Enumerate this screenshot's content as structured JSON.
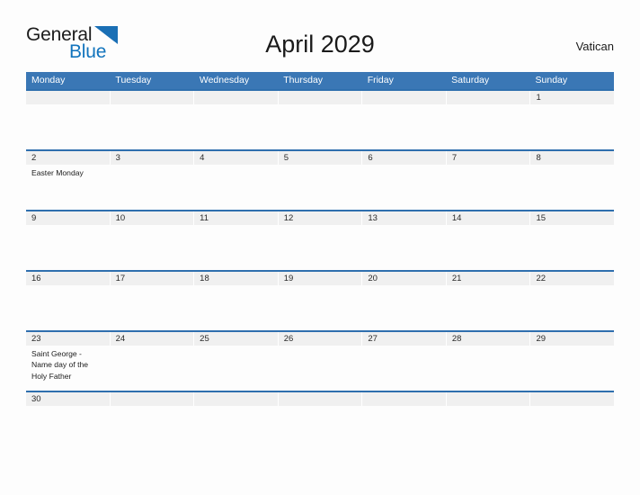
{
  "brand": {
    "name_part1": "General",
    "name_part2": "Blue",
    "mark": "triangle-flag",
    "accent_color": "#1a6fb5"
  },
  "header": {
    "title": "April 2029",
    "region": "Vatican"
  },
  "calendar": {
    "month": "April",
    "year": "2029",
    "header_color": "#3a77b5",
    "row_rule_color": "#2f6fae",
    "number_band_color": "#f0f0f0",
    "day_names": [
      "Monday",
      "Tuesday",
      "Wednesday",
      "Thursday",
      "Friday",
      "Saturday",
      "Sunday"
    ],
    "weeks": [
      {
        "height": "normal",
        "days": [
          {
            "number": "",
            "event": ""
          },
          {
            "number": "",
            "event": ""
          },
          {
            "number": "",
            "event": ""
          },
          {
            "number": "",
            "event": ""
          },
          {
            "number": "",
            "event": ""
          },
          {
            "number": "",
            "event": ""
          },
          {
            "number": "1",
            "event": ""
          }
        ]
      },
      {
        "height": "normal",
        "days": [
          {
            "number": "2",
            "event": "Easter Monday"
          },
          {
            "number": "3",
            "event": ""
          },
          {
            "number": "4",
            "event": ""
          },
          {
            "number": "5",
            "event": ""
          },
          {
            "number": "6",
            "event": ""
          },
          {
            "number": "7",
            "event": ""
          },
          {
            "number": "8",
            "event": ""
          }
        ]
      },
      {
        "height": "normal",
        "days": [
          {
            "number": "9",
            "event": ""
          },
          {
            "number": "10",
            "event": ""
          },
          {
            "number": "11",
            "event": ""
          },
          {
            "number": "12",
            "event": ""
          },
          {
            "number": "13",
            "event": ""
          },
          {
            "number": "14",
            "event": ""
          },
          {
            "number": "15",
            "event": ""
          }
        ]
      },
      {
        "height": "normal",
        "days": [
          {
            "number": "16",
            "event": ""
          },
          {
            "number": "17",
            "event": ""
          },
          {
            "number": "18",
            "event": ""
          },
          {
            "number": "19",
            "event": ""
          },
          {
            "number": "20",
            "event": ""
          },
          {
            "number": "21",
            "event": ""
          },
          {
            "number": "22",
            "event": ""
          }
        ]
      },
      {
        "height": "normal",
        "days": [
          {
            "number": "23",
            "event": "Saint George -\nName day of the\nHoly Father"
          },
          {
            "number": "24",
            "event": ""
          },
          {
            "number": "25",
            "event": ""
          },
          {
            "number": "26",
            "event": ""
          },
          {
            "number": "27",
            "event": ""
          },
          {
            "number": "28",
            "event": ""
          },
          {
            "number": "29",
            "event": ""
          }
        ]
      },
      {
        "height": "short",
        "days": [
          {
            "number": "30",
            "event": ""
          },
          {
            "number": "",
            "event": ""
          },
          {
            "number": "",
            "event": ""
          },
          {
            "number": "",
            "event": ""
          },
          {
            "number": "",
            "event": ""
          },
          {
            "number": "",
            "event": ""
          },
          {
            "number": "",
            "event": ""
          }
        ]
      }
    ]
  }
}
